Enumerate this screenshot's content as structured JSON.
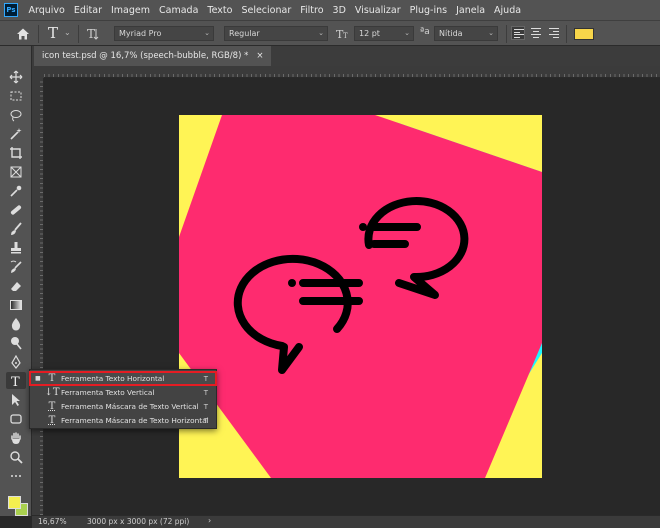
{
  "menu": {
    "logo": "Ps",
    "items": [
      "Arquivo",
      "Editar",
      "Imagem",
      "Camada",
      "Texto",
      "Selecionar",
      "Filtro",
      "3D",
      "Visualizar",
      "Plug-ins",
      "Janela",
      "Ajuda"
    ]
  },
  "options": {
    "tool_glyph": "T",
    "font_family": "Myriad Pro",
    "font_style": "Regular",
    "font_size": "12 pt",
    "antialias": "Nítida",
    "text_color": "#f7d54a"
  },
  "document": {
    "tab_title": "icon test.psd @ 16,7% (speech-bubble, RGB/8) *",
    "close_glyph": "×"
  },
  "canvas": {
    "colors": {
      "cyan": "#1ef6ff",
      "yellow": "#fff455",
      "pink": "#fe2b6f",
      "icon": "#000000"
    }
  },
  "flyout": {
    "items": [
      {
        "label": "Ferramenta Texto Horizontal",
        "shortcut": "T",
        "selected": true,
        "icon": "horizontal-type-icon"
      },
      {
        "label": "Ferramenta Texto Vertical",
        "shortcut": "T",
        "selected": false,
        "icon": "vertical-type-icon"
      },
      {
        "label": "Ferramenta Máscara de Texto Vertical",
        "shortcut": "T",
        "selected": false,
        "icon": "vertical-type-mask-icon"
      },
      {
        "label": "Ferramenta Máscara de Texto Horizontal",
        "shortcut": "T",
        "selected": false,
        "icon": "horizontal-type-mask-icon"
      }
    ]
  },
  "status": {
    "zoom": "16,67%",
    "doc_size": "3000 px x 3000 px (72 ppi)"
  },
  "swatches": {
    "foreground": "#f4ef4f",
    "background": "#a9d04f"
  }
}
